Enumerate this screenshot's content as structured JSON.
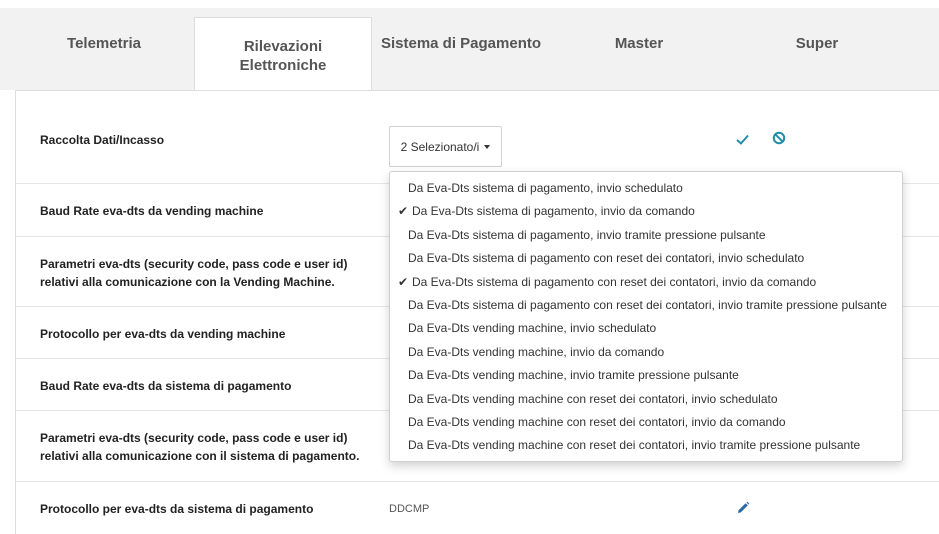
{
  "tabs": [
    {
      "label": "Telemetria",
      "active": false
    },
    {
      "label": "Rilevazioni Elettroniche",
      "active": true
    },
    {
      "label": "Sistema di Pagamento",
      "active": false
    },
    {
      "label": "Master",
      "active": false
    },
    {
      "label": "Super",
      "active": false
    }
  ],
  "rows": [
    {
      "label": "Raccolta Dati/Incasso",
      "value": ""
    },
    {
      "label": "Baud Rate eva-dts da vending machine",
      "value": ""
    },
    {
      "label": "Parametri eva-dts (security code, pass code e user id) relativi alla comunicazione con la Vending Machine.",
      "value": ""
    },
    {
      "label": "Protocollo per eva-dts da vending machine",
      "value": ""
    },
    {
      "label": "Baud Rate eva-dts da sistema di pagamento",
      "value": ""
    },
    {
      "label": "Parametri eva-dts (security code, pass code e user id) relativi alla comunicazione con il sistema di pagamento.",
      "value": ""
    },
    {
      "label": "Protocollo per eva-dts da sistema di pagamento",
      "value": "DDCMP"
    }
  ],
  "select": {
    "label": "2 Selezionato/i"
  },
  "icons": {
    "confirm": "check-icon",
    "cancel": "ban-icon",
    "edit": "pencil-icon",
    "accent": "#1f8ea6",
    "edit_color": "#2b6aa8"
  },
  "dropdown": {
    "items": [
      {
        "label": "Da Eva-Dts sistema di pagamento, invio schedulato",
        "checked": false
      },
      {
        "label": "Da Eva-Dts sistema di pagamento, invio da comando",
        "checked": true
      },
      {
        "label": "Da Eva-Dts sistema di pagamento, invio tramite pressione pulsante",
        "checked": false
      },
      {
        "label": "Da Eva-Dts sistema di pagamento con reset dei contatori, invio schedulato",
        "checked": false
      },
      {
        "label": "Da Eva-Dts sistema di pagamento con reset dei contatori, invio da comando",
        "checked": true
      },
      {
        "label": "Da Eva-Dts sistema di pagamento con reset dei contatori, invio tramite pressione pulsante",
        "checked": false
      },
      {
        "label": "Da Eva-Dts vending machine, invio schedulato",
        "checked": false
      },
      {
        "label": "Da Eva-Dts vending machine, invio da comando",
        "checked": false
      },
      {
        "label": "Da Eva-Dts vending machine, invio tramite pressione pulsante",
        "checked": false
      },
      {
        "label": "Da Eva-Dts vending machine con reset dei contatori, invio schedulato",
        "checked": false
      },
      {
        "label": "Da Eva-Dts vending machine con reset dei contatori, invio da comando",
        "checked": false
      },
      {
        "label": "Da Eva-Dts vending machine con reset dei contatori, invio tramite pressione pulsante",
        "checked": false
      }
    ]
  }
}
